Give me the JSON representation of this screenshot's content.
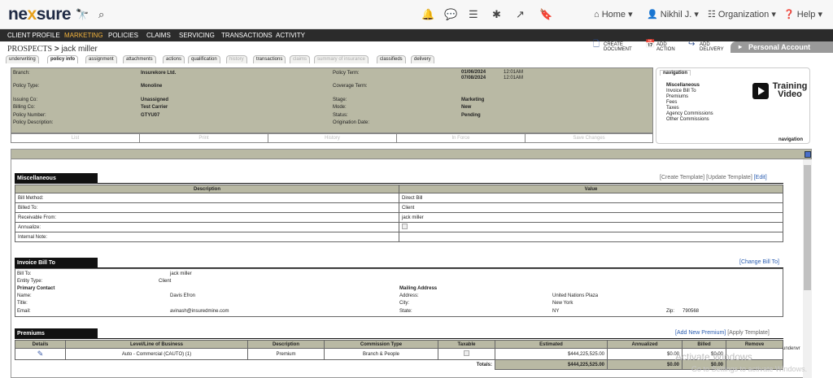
{
  "app": {
    "logo": "nexsure",
    "logo_x": "x"
  },
  "topbar": {
    "home": "Home",
    "user": "Nikhil J.",
    "org": "Organization",
    "help": "Help"
  },
  "nav": [
    "CLIENT PROFILE",
    "MARKETING",
    "POLICIES",
    "CLAIMS",
    "SERVICING",
    "TRANSACTIONS",
    "ACTIVITY"
  ],
  "breadcrumb": {
    "section": "PROSPECTS",
    "sep": ">",
    "name": "jack miller"
  },
  "header_actions": {
    "create": [
      "CREATE",
      "DOCUMENT"
    ],
    "add_action": [
      "ADD",
      "ACTION"
    ],
    "add_delivery": [
      "ADD",
      "DELIVERY"
    ]
  },
  "personal_account": "Personal Account",
  "tabs": [
    "underwriting",
    "policy info",
    "assignment",
    "attachments",
    "actions",
    "qualification",
    "history",
    "transactions",
    "claims",
    "summary of insurance",
    "classifieds",
    "delivery"
  ],
  "policy": {
    "branch_label": "Branch:",
    "branch": "Insurekore Ltd.",
    "policy_type_label": "Policy Type:",
    "policy_type": "Monoline",
    "issuing_label": "Issuing Co:",
    "issuing": "Unassigned",
    "billing_label": "Billing Co:",
    "billing": "Test Carrier",
    "number_label": "Policy Number:",
    "number": "GTYU07",
    "desc_label": "Policy Description:",
    "term_label": "Policy Term:",
    "term_start": "01/06/2024",
    "term_start_time": "12:01AM",
    "term_end": "07/08/2024",
    "term_end_time": "12:01AM",
    "coverage_label": "Coverage Term:",
    "stage_label": "Stage:",
    "stage": "Marketing",
    "mode_label": "Mode:",
    "mode": "New",
    "status_label": "Status:",
    "status": "Pending",
    "origination_label": "Origination Date:"
  },
  "policy_actions": [
    "List",
    "Print",
    "History",
    "In Force",
    "Save Changes"
  ],
  "navigation": {
    "tab": "navigation",
    "footer": "navigation",
    "items": [
      "Miscellaneous",
      "Invoice Bill To",
      "Premiums",
      "Fees",
      "Taxes",
      "Agency Commissions",
      "Other Commissions"
    ],
    "training": [
      "Training",
      "Video"
    ]
  },
  "misc": {
    "title": "Miscellaneous",
    "links": {
      "create": "[Create Template]",
      "update": "[Update Template]",
      "edit": "[Edit]"
    },
    "headers": [
      "Description",
      "Value"
    ],
    "rows": [
      [
        "Bill Method:",
        "Direct Bill"
      ],
      [
        "Billed To:",
        "Client"
      ],
      [
        "Receivable From:",
        "jack miller"
      ],
      [
        "Annualize:",
        ""
      ],
      [
        "Internal Note:",
        ""
      ]
    ]
  },
  "invoice": {
    "title": "Invoice Bill To",
    "link": "[Change Bill To]",
    "bill_to_label": "Bill To:",
    "bill_to": "jack miller",
    "entity_label": "Entity Type:",
    "entity": "Client",
    "primary_contact": "Primary Contact",
    "name_label": "Name:",
    "name": "Davis Efron",
    "title_label": "Title:",
    "email_label": "Email:",
    "email": "avinash@insuredmine.com",
    "mailing": "Mailing Address",
    "address_label": "Address:",
    "address": "United Nations Plaza",
    "city_label": "City:",
    "city": "New York",
    "state_label": "State:",
    "state": "NY",
    "zip_label": "Zip:",
    "zip": "790568"
  },
  "premiums": {
    "title": "Premiums",
    "links": {
      "add": "[Add New Premium]",
      "apply": "[Apply Template]"
    },
    "headers": [
      "Details",
      "Level/Line of Business",
      "Description",
      "Commission Type",
      "Taxable",
      "Estimated",
      "Annualized",
      "Billed",
      "Remove"
    ],
    "row": {
      "lob": "Auto - Commercial (CAUTO) (1)",
      "description": "Premium",
      "commission": "Branch & People",
      "estimated": "$444,225,525.00",
      "annualized": "$0.00",
      "billed": "$0.00"
    },
    "totals_label": "Totals:",
    "total_estimated": "$444,225,525.00",
    "total_annualized": "$0.00",
    "total_billed": "$0.00"
  },
  "side_text": "underwr",
  "watermark": {
    "line1": "Activate Windows",
    "line2": "Go to Settings to activate Windows."
  }
}
